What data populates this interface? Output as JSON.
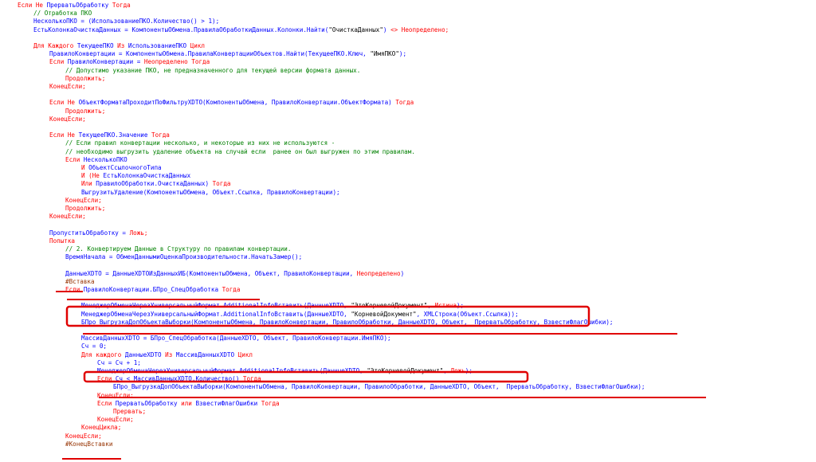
{
  "code_lines": [
    {
      "indent": 0,
      "parts": [
        {
          "k": "kw",
          "t": "Если Не "
        },
        {
          "k": "tx",
          "t": "ПрерватьОбработку "
        },
        {
          "k": "kw",
          "t": "Тогда"
        }
      ]
    },
    {
      "indent": 1,
      "parts": [
        {
          "k": "cm",
          "t": "// Отработка ПКО"
        }
      ]
    },
    {
      "indent": 1,
      "parts": [
        {
          "k": "tx",
          "t": "НесколькоПКО = (ИспользованиеПКО.Количество() > 1);"
        }
      ]
    },
    {
      "indent": 1,
      "parts": [
        {
          "k": "tx",
          "t": "ЕстьКолонкаОчисткаДанных = КомпонентыОбмена.ПравилаОбработкиДанных.Колонки.Найти("
        },
        {
          "k": "str",
          "t": "\"ОчисткаДанных\""
        },
        {
          "k": "tx",
          "t": ") "
        },
        {
          "k": "kw",
          "t": "<> Неопределено;"
        }
      ]
    },
    {
      "indent": 0,
      "parts": []
    },
    {
      "indent": 1,
      "parts": [
        {
          "k": "kw",
          "t": "Для Каждого "
        },
        {
          "k": "tx",
          "t": "ТекущееПКО "
        },
        {
          "k": "kw",
          "t": "Из "
        },
        {
          "k": "tx",
          "t": "ИспользованиеПКО "
        },
        {
          "k": "kw",
          "t": "Цикл"
        }
      ]
    },
    {
      "indent": 2,
      "parts": [
        {
          "k": "tx",
          "t": "ПравилоКонвертации = КомпонентыОбмена.ПравилаКонвертацииОбъектов.Найти(ТекущееПКО.Ключ, "
        },
        {
          "k": "str",
          "t": "\"ИмяПКО\""
        },
        {
          "k": "tx",
          "t": ");"
        }
      ]
    },
    {
      "indent": 2,
      "parts": [
        {
          "k": "kw",
          "t": "Если "
        },
        {
          "k": "tx",
          "t": "ПравилоКонвертации = "
        },
        {
          "k": "kw",
          "t": "Неопределено Тогда"
        }
      ]
    },
    {
      "indent": 3,
      "parts": [
        {
          "k": "cm",
          "t": "// Допустимо указание ПКО, не предназначенного для текущей версии формата данных."
        }
      ]
    },
    {
      "indent": 3,
      "parts": [
        {
          "k": "kw",
          "t": "Продолжить;"
        }
      ]
    },
    {
      "indent": 2,
      "parts": [
        {
          "k": "kw",
          "t": "КонецЕсли;"
        }
      ]
    },
    {
      "indent": 0,
      "parts": []
    },
    {
      "indent": 2,
      "parts": [
        {
          "k": "kw",
          "t": "Если Не "
        },
        {
          "k": "tx",
          "t": "ОбъектФорматаПроходитПоФильтруXDTO(КомпонентыОбмена, ПравилоКонвертации.ОбъектФормата) "
        },
        {
          "k": "kw",
          "t": "Тогда"
        }
      ]
    },
    {
      "indent": 3,
      "parts": [
        {
          "k": "kw",
          "t": "Продолжить;"
        }
      ]
    },
    {
      "indent": 2,
      "parts": [
        {
          "k": "kw",
          "t": "КонецЕсли;"
        }
      ]
    },
    {
      "indent": 0,
      "parts": []
    },
    {
      "indent": 2,
      "parts": [
        {
          "k": "kw",
          "t": "Если Не "
        },
        {
          "k": "tx",
          "t": "ТекущееПКО.Значение "
        },
        {
          "k": "kw",
          "t": "Тогда"
        }
      ]
    },
    {
      "indent": 3,
      "parts": [
        {
          "k": "cm",
          "t": "// Если правил конвертации несколько, и некоторые из них не используются -"
        }
      ]
    },
    {
      "indent": 3,
      "parts": [
        {
          "k": "cm",
          "t": "// необходимо выгрузить удаление объекта на случай если  ранее он был выгружен по этим правилам."
        }
      ]
    },
    {
      "indent": 3,
      "parts": [
        {
          "k": "kw",
          "t": "Если "
        },
        {
          "k": "tx",
          "t": "НесколькоПКО"
        }
      ]
    },
    {
      "indent": 4,
      "parts": [
        {
          "k": "kw",
          "t": "И "
        },
        {
          "k": "tx",
          "t": "ОбъектСсылочногоТипа"
        }
      ]
    },
    {
      "indent": 4,
      "parts": [
        {
          "k": "kw",
          "t": "И (Не "
        },
        {
          "k": "tx",
          "t": "ЕстьКолонкаОчисткаДанных"
        }
      ]
    },
    {
      "indent": 4,
      "parts": [
        {
          "k": "kw",
          "t": "Или "
        },
        {
          "k": "tx",
          "t": "ПравилоОбработки.ОчисткаДанных) "
        },
        {
          "k": "kw",
          "t": "Тогда"
        }
      ]
    },
    {
      "indent": 4,
      "parts": [
        {
          "k": "tx",
          "t": "ВыгрузитьУдаление(КомпонентыОбмена, Объект.Ссылка, ПравилоКонвертации);"
        }
      ]
    },
    {
      "indent": 3,
      "parts": [
        {
          "k": "kw",
          "t": "КонецЕсли;"
        }
      ]
    },
    {
      "indent": 3,
      "parts": [
        {
          "k": "kw",
          "t": "Продолжить;"
        }
      ]
    },
    {
      "indent": 2,
      "parts": [
        {
          "k": "kw",
          "t": "КонецЕсли;"
        }
      ]
    },
    {
      "indent": 0,
      "parts": []
    },
    {
      "indent": 2,
      "parts": [
        {
          "k": "tx",
          "t": "ПропуститьОбработку = "
        },
        {
          "k": "kw",
          "t": "Ложь;"
        }
      ]
    },
    {
      "indent": 2,
      "parts": [
        {
          "k": "kw",
          "t": "Попытка"
        }
      ]
    },
    {
      "indent": 3,
      "parts": [
        {
          "k": "cm",
          "t": "// 2. Конвертируем Данные в Структуру по правилам конвертации."
        }
      ]
    },
    {
      "indent": 3,
      "parts": [
        {
          "k": "tx",
          "t": "ВремяНачала = ОбменДаннымиОценкаПроизводительности.НачатьЗамер();"
        }
      ]
    },
    {
      "indent": 0,
      "parts": []
    },
    {
      "indent": 3,
      "parts": [
        {
          "k": "tx",
          "t": "ДанныеXDTO = ДанныеXDTOИзДанныхИБ(КомпонентыОбмена, Объект, ПравилоКонвертации, "
        },
        {
          "k": "kw",
          "t": "Неопределено"
        },
        {
          "k": "tx",
          "t": ")"
        }
      ]
    },
    {
      "indent": 3,
      "parts": [
        {
          "k": "pp",
          "t": "#Вставка"
        }
      ]
    },
    {
      "indent": 3,
      "parts": [
        {
          "k": "kw",
          "t": "Если "
        },
        {
          "k": "tx",
          "t": "ПравилоКонвертации.БПро_СпецОбработка "
        },
        {
          "k": "kw",
          "t": "Тогда"
        }
      ]
    },
    {
      "indent": 0,
      "parts": []
    },
    {
      "indent": 4,
      "parts": [
        {
          "k": "tx",
          "t": "МенеджерОбменаЧерезУниверсальныйФормат.AdditionalInfoВставить(ДанныеXDTO, "
        },
        {
          "k": "str",
          "t": "\"ЭтоКорневойДокумент\""
        },
        {
          "k": "tx",
          "t": ", "
        },
        {
          "k": "kw",
          "t": "Истина"
        },
        {
          "k": "tx",
          "t": ");"
        }
      ]
    },
    {
      "indent": 4,
      "parts": [
        {
          "k": "tx",
          "t": "МенеджерОбменаЧерезУниверсальныйФормат.AdditionalInfoВставить(ДанныеXDTO, "
        },
        {
          "k": "str",
          "t": "\"КорневойДокумент\""
        },
        {
          "k": "tx",
          "t": ", XMLСтрока(Объект.Ссылка));"
        }
      ]
    },
    {
      "indent": 4,
      "parts": [
        {
          "k": "tx",
          "t": "БПро_ВыгрузкаДопОбъектаВыборки(КомпонентыОбмена, ПравилоКонвертации, ПравилоОбработки, ДанныеXDTO, Объект,  ПрерватьОбработку, ВзвестиФлагОшибки);"
        }
      ]
    },
    {
      "indent": 0,
      "parts": []
    },
    {
      "indent": 4,
      "parts": [
        {
          "k": "tx",
          "t": "МассивДанныхXDTO = БПро_СпецОбработка(ДанныеXDTO, Объект, ПравилоКонвертации.ИмяПКО);"
        }
      ]
    },
    {
      "indent": 4,
      "parts": [
        {
          "k": "tx",
          "t": "Сч = 0;"
        }
      ]
    },
    {
      "indent": 4,
      "parts": [
        {
          "k": "kw",
          "t": "Для каждого "
        },
        {
          "k": "tx",
          "t": "ДанныеXDTO "
        },
        {
          "k": "kw",
          "t": "Из "
        },
        {
          "k": "tx",
          "t": "МассивДанныхXDTO "
        },
        {
          "k": "kw",
          "t": "Цикл"
        }
      ]
    },
    {
      "indent": 5,
      "parts": [
        {
          "k": "tx",
          "t": "Сч = Сч + 1;"
        }
      ]
    },
    {
      "indent": 5,
      "parts": [
        {
          "k": "tx",
          "t": "МенеджерОбменаЧерезУниверсальныйФормат.AdditionalInfoВставить(ДанныеXDTO, "
        },
        {
          "k": "str",
          "t": "\"ЭтоКорневойДокумент\""
        },
        {
          "k": "tx",
          "t": ", "
        },
        {
          "k": "kw",
          "t": "Ложь"
        },
        {
          "k": "tx",
          "t": ");"
        }
      ]
    },
    {
      "indent": 5,
      "parts": [
        {
          "k": "kw",
          "t": "Если "
        },
        {
          "k": "tx",
          "t": "Сч < МассивДанныхXDTO.Количество() "
        },
        {
          "k": "kw",
          "t": "Тогда"
        }
      ]
    },
    {
      "indent": 6,
      "parts": [
        {
          "k": "tx",
          "t": "БПро_ВыгрузкаДопОбъектаВыборки(КомпонентыОбмена, ПравилоКонвертации, ПравилоОбработки, ДанныеXDTO, Объект,  ПрерватьОбработку, ВзвестиФлагОшибки);"
        }
      ]
    },
    {
      "indent": 5,
      "parts": [
        {
          "k": "kw",
          "t": "КонецЕсли;"
        }
      ]
    },
    {
      "indent": 5,
      "parts": [
        {
          "k": "kw",
          "t": "Если "
        },
        {
          "k": "tx",
          "t": "ПрерватьОбработку "
        },
        {
          "k": "kw",
          "t": "или "
        },
        {
          "k": "tx",
          "t": "ВзвестиФлагОшибки "
        },
        {
          "k": "kw",
          "t": "Тогда"
        }
      ]
    },
    {
      "indent": 6,
      "parts": [
        {
          "k": "kw",
          "t": "Прервать;"
        }
      ]
    },
    {
      "indent": 5,
      "parts": [
        {
          "k": "kw",
          "t": "КонецЕсли;"
        }
      ]
    },
    {
      "indent": 4,
      "parts": [
        {
          "k": "kw",
          "t": "КонецЦикла;"
        }
      ]
    },
    {
      "indent": 3,
      "parts": [
        {
          "k": "kw",
          "t": "КонецЕсли;"
        }
      ]
    },
    {
      "indent": 3,
      "parts": [
        {
          "k": "pp",
          "t": "#КонецВставки"
        }
      ]
    }
  ],
  "annotation_color": "#e00000"
}
